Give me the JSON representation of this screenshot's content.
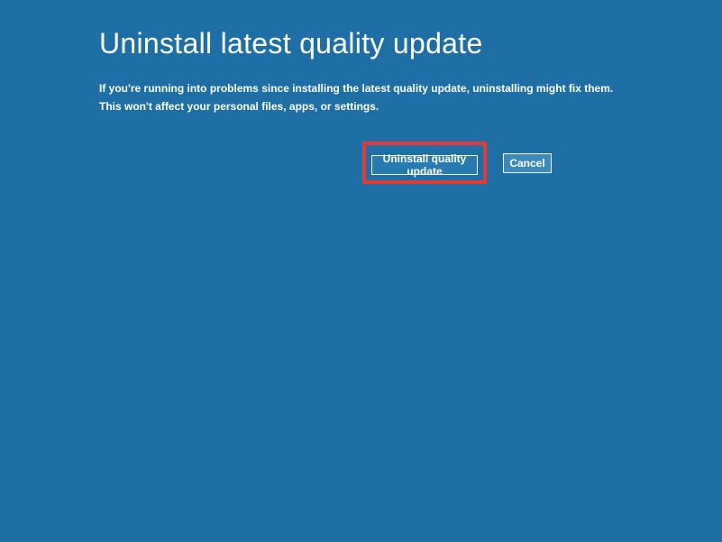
{
  "title": "Uninstall latest quality update",
  "description": {
    "line1": "If you're running into problems since installing the latest quality update, uninstalling might fix them.",
    "line2": "This won't affect your personal files, apps, or settings."
  },
  "buttons": {
    "uninstall": "Uninstall quality update",
    "cancel": "Cancel"
  }
}
